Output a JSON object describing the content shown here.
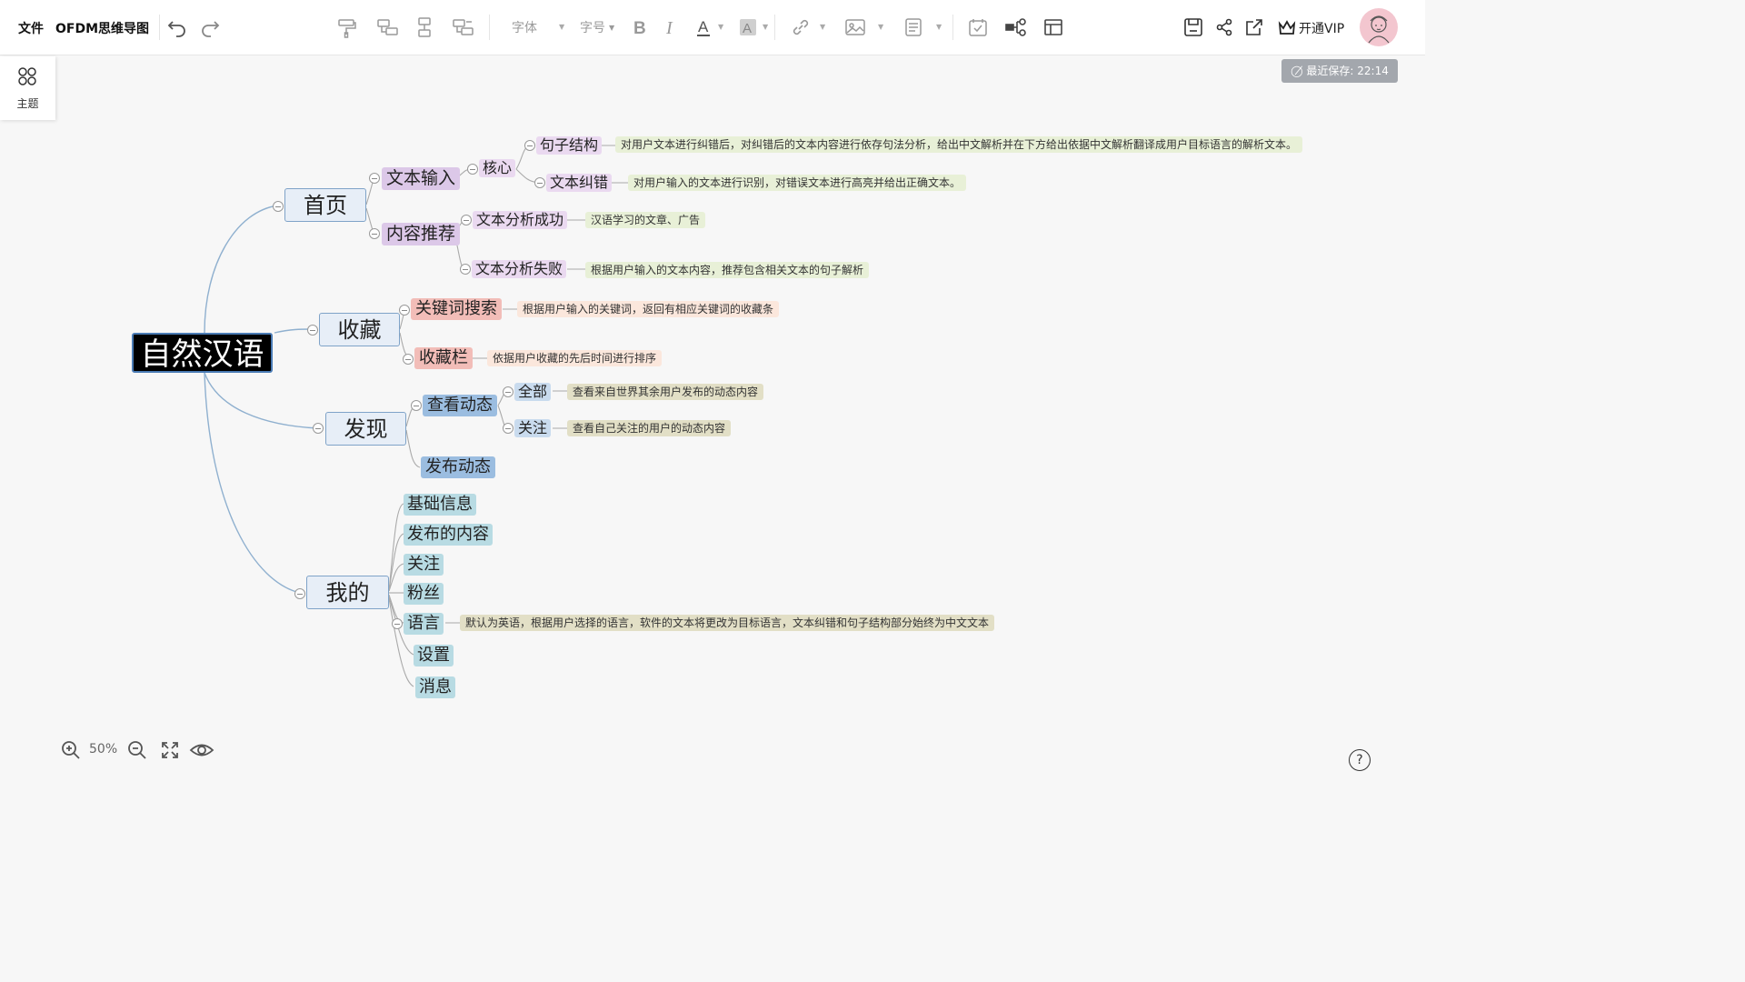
{
  "menu": {
    "file": "文件",
    "title": "OFDM思维导图"
  },
  "toolbar": {
    "font": "字体",
    "font_size": "字号",
    "vip": "开通VIP",
    "accent": "#111111"
  },
  "side": {
    "theme": "主题"
  },
  "status": {
    "last_saved": "最近保存: 22:14"
  },
  "zoom": {
    "level": "50%"
  },
  "help": {
    "label": "?"
  },
  "mindmap": {
    "root": "自然汉语",
    "branches": {
      "home": {
        "label": "首页",
        "text_input": "文本输入",
        "core": "核心",
        "sentence_structure": "句子结构",
        "sentence_structure_note": "对用户文本进行纠错后，对纠错后的文本内容进行依存句法分析，给出中文解析并在下方给出依据中文解析翻译成用户目标语言的解析文本。",
        "text_correction": "文本纠错",
        "text_correction_note": "对用户输入的文本进行识别，对错误文本进行高亮并给出正确文本。",
        "content_recommend": "内容推荐",
        "analysis_success": "文本分析成功",
        "analysis_success_note": "汉语学习的文章、广告",
        "analysis_fail": "文本分析失败",
        "analysis_fail_note": "根据用户输入的文本内容，推荐包含相关文本的句子解析"
      },
      "favorites": {
        "label": "收藏",
        "keyword_search": "关键词搜索",
        "keyword_search_note": "根据用户输入的关键词，返回有相应关键词的收藏条",
        "favorites_bar": "收藏栏",
        "favorites_bar_note": "依据用户收藏的先后时间进行排序"
      },
      "discover": {
        "label": "发现",
        "view_posts": "查看动态",
        "all": "全部",
        "all_note": "查看来自世界其余用户发布的动态内容",
        "following": "关注",
        "following_note": "查看自己关注的用户的动态内容",
        "publish_post": "发布动态"
      },
      "mine": {
        "label": "我的",
        "basic_info": "基础信息",
        "published": "发布的内容",
        "following": "关注",
        "fans": "粉丝",
        "language": "语言",
        "language_note": "默认为英语，根据用户选择的语言，软件的文本将更改为目标语言，文本纠错和句子结构部分始终为中文文本",
        "settings": "设置",
        "messages": "消息"
      }
    }
  }
}
